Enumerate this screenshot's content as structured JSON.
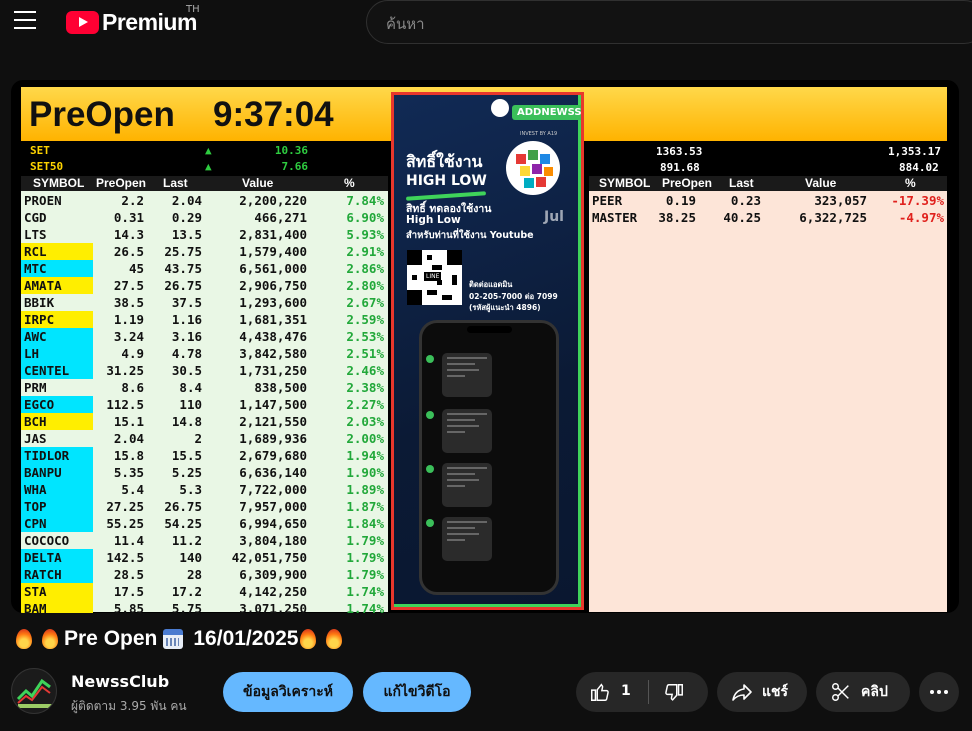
{
  "header": {
    "logo_text": "Premium",
    "region": "TH",
    "search_placeholder": "ค้นหา"
  },
  "video": {
    "preopen_label": "PreOpen",
    "time": "9:37:04",
    "left_indexes": [
      {
        "name": "SET",
        "value": "10.36"
      },
      {
        "name": "SET50",
        "value": "7.66"
      }
    ],
    "right_indexes": [
      {
        "a": "1363.53",
        "b": "1,353.17"
      },
      {
        "a": "891.68",
        "b": "884.02"
      }
    ],
    "columns": [
      "SYMBOL",
      "PreOpen",
      "Last",
      "Value",
      "%"
    ],
    "left_rows": [
      {
        "symbol": "PROEN",
        "pre": "2.2",
        "last": "2.04",
        "value": "2,200,220",
        "pct": "7.84%",
        "hl": ""
      },
      {
        "symbol": "CGD",
        "pre": "0.31",
        "last": "0.29",
        "value": "466,271",
        "pct": "6.90%",
        "hl": ""
      },
      {
        "symbol": "LTS",
        "pre": "14.3",
        "last": "13.5",
        "value": "2,831,400",
        "pct": "5.93%",
        "hl": ""
      },
      {
        "symbol": "RCL",
        "pre": "26.5",
        "last": "25.75",
        "value": "1,579,400",
        "pct": "2.91%",
        "hl": "#ffee00"
      },
      {
        "symbol": "MTC",
        "pre": "45",
        "last": "43.75",
        "value": "6,561,000",
        "pct": "2.86%",
        "hl": "#00e5ff"
      },
      {
        "symbol": "AMATA",
        "pre": "27.5",
        "last": "26.75",
        "value": "2,906,750",
        "pct": "2.80%",
        "hl": "#ffee00"
      },
      {
        "symbol": "BBIK",
        "pre": "38.5",
        "last": "37.5",
        "value": "1,293,600",
        "pct": "2.67%",
        "hl": ""
      },
      {
        "symbol": "IRPC",
        "pre": "1.19",
        "last": "1.16",
        "value": "1,681,351",
        "pct": "2.59%",
        "hl": "#ffee00"
      },
      {
        "symbol": "AWC",
        "pre": "3.24",
        "last": "3.16",
        "value": "4,438,476",
        "pct": "2.53%",
        "hl": "#00e5ff"
      },
      {
        "symbol": "LH",
        "pre": "4.9",
        "last": "4.78",
        "value": "3,842,580",
        "pct": "2.51%",
        "hl": "#00e5ff"
      },
      {
        "symbol": "CENTEL",
        "pre": "31.25",
        "last": "30.5",
        "value": "1,731,250",
        "pct": "2.46%",
        "hl": "#00e5ff"
      },
      {
        "symbol": "PRM",
        "pre": "8.6",
        "last": "8.4",
        "value": "838,500",
        "pct": "2.38%",
        "hl": ""
      },
      {
        "symbol": "EGCO",
        "pre": "112.5",
        "last": "110",
        "value": "1,147,500",
        "pct": "2.27%",
        "hl": "#00e5ff"
      },
      {
        "symbol": "BCH",
        "pre": "15.1",
        "last": "14.8",
        "value": "2,121,550",
        "pct": "2.03%",
        "hl": "#ffee00"
      },
      {
        "symbol": "JAS",
        "pre": "2.04",
        "last": "2",
        "value": "1,689,936",
        "pct": "2.00%",
        "hl": ""
      },
      {
        "symbol": "TIDLOR",
        "pre": "15.8",
        "last": "15.5",
        "value": "2,679,680",
        "pct": "1.94%",
        "hl": "#00e5ff"
      },
      {
        "symbol": "BANPU",
        "pre": "5.35",
        "last": "5.25",
        "value": "6,636,140",
        "pct": "1.90%",
        "hl": "#00e5ff"
      },
      {
        "symbol": "WHA",
        "pre": "5.4",
        "last": "5.3",
        "value": "7,722,000",
        "pct": "1.89%",
        "hl": "#00e5ff"
      },
      {
        "symbol": "TOP",
        "pre": "27.25",
        "last": "26.75",
        "value": "7,957,000",
        "pct": "1.87%",
        "hl": "#00e5ff"
      },
      {
        "symbol": "CPN",
        "pre": "55.25",
        "last": "54.25",
        "value": "6,994,650",
        "pct": "1.84%",
        "hl": "#00e5ff"
      },
      {
        "symbol": "COCOCO",
        "pre": "11.4",
        "last": "11.2",
        "value": "3,804,180",
        "pct": "1.79%",
        "hl": ""
      },
      {
        "symbol": "DELTA",
        "pre": "142.5",
        "last": "140",
        "value": "42,051,750",
        "pct": "1.79%",
        "hl": "#00e5ff"
      },
      {
        "symbol": "RATCH",
        "pre": "28.5",
        "last": "28",
        "value": "6,309,900",
        "pct": "1.79%",
        "hl": "#00e5ff"
      },
      {
        "symbol": "STA",
        "pre": "17.5",
        "last": "17.2",
        "value": "4,142,250",
        "pct": "1.74%",
        "hl": "#ffee00"
      },
      {
        "symbol": "BAM",
        "pre": "5.85",
        "last": "5.75",
        "value": "3,071,250",
        "pct": "1.74%",
        "hl": "#ffee00"
      }
    ],
    "right_rows": [
      {
        "symbol": "PEER",
        "pre": "0.19",
        "last": "0.23",
        "value": "323,057",
        "pct": "-17.39%"
      },
      {
        "symbol": "MASTER",
        "pre": "38.25",
        "last": "40.25",
        "value": "6,322,725",
        "pct": "-4.97%"
      }
    ],
    "ad": {
      "badge": "ADDNEWSS",
      "badge_sub": "INVEST BY A19",
      "headline1": "สิทธิ์ใช้งาน",
      "headline2": "HIGH LOW",
      "line1": "สิทธิ์ ทดลองใช้งาน",
      "line2": "High Low",
      "line3": "สำหรับท่านที่ใช้งาน Youtube",
      "qr_label": "LINE",
      "contact1": "ติดต่อแอดมิน",
      "contact2": "02-205-7000 ต่อ 7099",
      "contact3": "(รหัสผู้แนะนำ 4896)",
      "jul": "Jul"
    }
  },
  "title": {
    "text": "Pre Open",
    "date": "16/01/2025"
  },
  "channel": {
    "name": "NewssClub",
    "subscribers": "ผู้ติดตาม 3.95 พัน คน",
    "btn_analysis": "ข้อมูลวิเคราะห์",
    "btn_edit": "แก้ไขวิดีโอ",
    "likes": "1",
    "share": "แชร์",
    "clip": "คลิป"
  },
  "colors": {
    "accent_red": "#ff0033",
    "pill_blue": "#65b8ff",
    "positive": "#22a83a",
    "negative": "#e0211d"
  }
}
